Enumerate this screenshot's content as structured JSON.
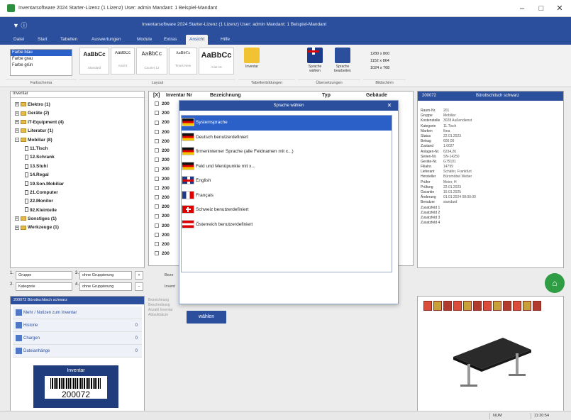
{
  "app_title": "Inventarsoftware 2024 Starter-Lizenz (1 Lizenz)   User: admin   Mandant: 1 Beispiel-Mandant",
  "window_title": "Inventarsoftware 2024 Starter-Lizenz (1 Lizenz)   User: admin   Mandant: 1 Beispiel-Mandant",
  "menu_tabs": [
    "Datei",
    "Start",
    "Tabellen",
    "Auswertungen",
    "Module",
    "Extras",
    "Ansicht",
    "Hilfe"
  ],
  "active_tab": "Ansicht",
  "ribbon": {
    "color_schemes": [
      "Farbe blau",
      "Farbe grau",
      "Farbe grün"
    ],
    "styles": [
      {
        "sample": "AaBbCc",
        "name": "Standard"
      },
      {
        "sample": "AaBbCc",
        "name": "Arial 8"
      },
      {
        "sample": "AaBbCc",
        "name": "Courier 12"
      },
      {
        "sample": "AaBbCc",
        "name": "Times New"
      },
      {
        "sample": "AaBbCc",
        "name": "Arial 15"
      }
    ],
    "inventar_label": "Inventar",
    "sprache_waehlen": "Sprache wählen",
    "sprache_bearbeiten": "Sprache bearbeiten",
    "resolutions": [
      "1280 x 800",
      "1152 x 864",
      "1024 x 768"
    ],
    "groups": [
      "Farbschema",
      "Layout",
      "Tabellenbildungen",
      "Übersetzungen",
      "Bildschirm"
    ]
  },
  "tree": {
    "header": "Inventar",
    "items": [
      {
        "label": "Elektro  (1)",
        "level": 0,
        "exp": "+"
      },
      {
        "label": "Geräte  (2)",
        "level": 0,
        "exp": "+"
      },
      {
        "label": "IT-Equipment  (4)",
        "level": 0,
        "exp": "+"
      },
      {
        "label": "Literatur  (1)",
        "level": 0,
        "exp": "+"
      },
      {
        "label": "Mobiliar  (8)",
        "level": 0,
        "exp": "-"
      },
      {
        "label": "11.Tisch",
        "level": 1
      },
      {
        "label": "12.Schrank",
        "level": 1
      },
      {
        "label": "13.Stuhl",
        "level": 1
      },
      {
        "label": "14.Regal",
        "level": 1
      },
      {
        "label": "19.Son.Mobiliar",
        "level": 1
      },
      {
        "label": "21.Computer",
        "level": 1
      },
      {
        "label": "22.Monitor",
        "level": 1
      },
      {
        "label": "92.Kleinteile",
        "level": 1
      },
      {
        "label": "Sonstiges  (1)",
        "level": 0,
        "exp": "+"
      },
      {
        "label": "Werkzeuge  (1)",
        "level": 0,
        "exp": "+"
      }
    ]
  },
  "grouping": {
    "g1_num": "1.",
    "g1": "Gruppe",
    "g2_num": "2.",
    "g2": "Kategorie",
    "g3_num": "3.",
    "g3": "ohne Gruppierung",
    "g4_num": "4.",
    "g4": "ohne Gruppierung",
    "b1": "+",
    "b2": "−"
  },
  "info": {
    "bar": "200072 Bürotischtisch schwarz",
    "items": [
      "Mehr / Notizen zum Inventar",
      "Historie",
      "Chargen",
      "Dateianhänge"
    ],
    "counts": [
      "",
      "0",
      "0",
      "0"
    ],
    "label_title": "Inventar",
    "barcode": "200072"
  },
  "table": {
    "columns": [
      "[X]",
      "Inventar Nr",
      "Bezeichnung",
      "Typ",
      "Gebäude"
    ],
    "rows": [
      "200",
      "200",
      "200",
      "200",
      "200",
      "200",
      "200",
      "200",
      "200",
      "200",
      "200",
      "200",
      "200",
      "200",
      "200",
      "200",
      "200"
    ],
    "below": [
      "Beze",
      "Invent"
    ],
    "desc": [
      "Bezeichnung",
      "Beschreibung",
      "Anzahl Inventar",
      "Ablaufdatum"
    ]
  },
  "dialog": {
    "title": "Sprache wählen",
    "close": "✕",
    "items": [
      {
        "flag": "de",
        "label": "Systemsprache"
      },
      {
        "flag": "de",
        "label": "Deutsch benutzerdefiniert"
      },
      {
        "flag": "de",
        "label": "firmeninterner Sprache (alle Feldnamen mit x...)"
      },
      {
        "flag": "de",
        "label": "Feld und Menüpunkte mit x..."
      },
      {
        "flag": "en",
        "label": "English"
      },
      {
        "flag": "fr",
        "label": "Français"
      },
      {
        "flag": "ch",
        "label": "Schweiz benutzerdefiniert"
      },
      {
        "flag": "at",
        "label": "Österreich benutzerdefiniert"
      }
    ],
    "button": "wählen"
  },
  "detail": {
    "bar_id": "200072",
    "bar_title": "Bürotischtisch schwarz",
    "props": [
      [
        "Raum-Nr.",
        "201"
      ],
      [
        "Gruppe",
        "Mobiliar"
      ],
      [
        "Kostenstelle",
        "3028 Außendienst"
      ],
      [
        "Kategorie",
        "11.Tisch"
      ],
      [
        "Marken",
        "Ikea"
      ],
      [
        "Status",
        "22.01.2023"
      ],
      [
        "Betrag",
        "600,00"
      ],
      [
        "Zustand",
        "1.0027"
      ],
      [
        "Anlagen-Nr.",
        "6234,26"
      ],
      [
        "Serien-Nr.",
        "SN-14250"
      ],
      [
        "Geräte-Nr.",
        "G75101"
      ],
      [
        "Filialnr.",
        "14799"
      ],
      [
        "Lieferant",
        "Schäfer, Frankfurt"
      ],
      [
        "Hersteller",
        "Büromöbel Weber"
      ],
      [
        "Prüfer",
        "Meier, H"
      ],
      [
        "Prüfung",
        "22.01.2023"
      ],
      [
        "Garantie",
        "15.01.2025"
      ],
      [
        "Änderung",
        "01.01.2024 08:00:00"
      ],
      [
        "Benutzer",
        "standard"
      ],
      [
        "Zusatzfeld 1",
        ""
      ],
      [
        "Zusatzfeld 2",
        ""
      ],
      [
        "Zusatzfeld 3",
        ""
      ],
      [
        "Zusatzfeld 4",
        ""
      ]
    ]
  },
  "status": {
    "left": "",
    "mid": "NUM",
    "right": "11:20:54"
  },
  "colors": {
    "accent": "#2b4f9c",
    "selection": "#2b60c8",
    "green": "#2e9d43"
  }
}
